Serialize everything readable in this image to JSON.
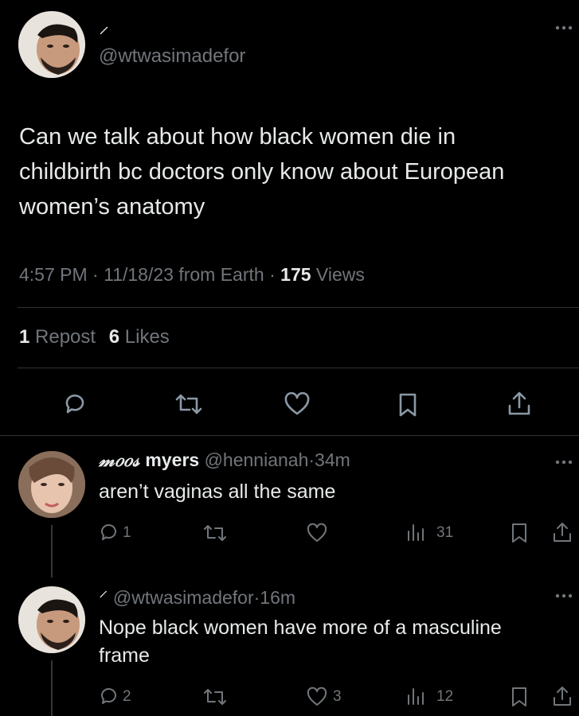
{
  "main_tweet": {
    "name_glyph": "⸍",
    "handle": "@wtwasimadefor",
    "text_line1": "Can we talk about how black women die in",
    "text_line2": "childbirth bc doctors only know about European",
    "text_line3": "women’s anatomy",
    "time": "4:57 PM",
    "date": "11/18/23",
    "source": "from Earth",
    "views_count": "175",
    "views_label": "Views",
    "reposts_count": "1",
    "reposts_label": "Repost",
    "likes_count": "6",
    "likes_label": "Likes",
    "sep": "·"
  },
  "replies": [
    {
      "name_script": "𝓂𝑜𝑜𝓈",
      "name": "myers",
      "handle": "@hennianah",
      "time": "34m",
      "text": "aren’t vaginas all the same",
      "reply_count": "1",
      "repost_count": "",
      "like_count": "",
      "views_count": "31"
    },
    {
      "name_glyph": "⸍",
      "handle": "@wtwasimadefor",
      "time": "16m",
      "text_line1": "Nope black women have more of a masculine",
      "text_line2": "frame",
      "reply_count": "2",
      "repost_count": "",
      "like_count": "3",
      "views_count": "12"
    }
  ],
  "icons": {
    "more": "more-icon",
    "reply": "reply-icon",
    "repost": "repost-icon",
    "like": "like-icon",
    "bookmark": "bookmark-icon",
    "share": "share-icon",
    "views": "views-icon"
  },
  "colors": {
    "background": "#000000",
    "text": "#e7e9ea",
    "muted": "#71767b",
    "divider": "#2f3336"
  }
}
